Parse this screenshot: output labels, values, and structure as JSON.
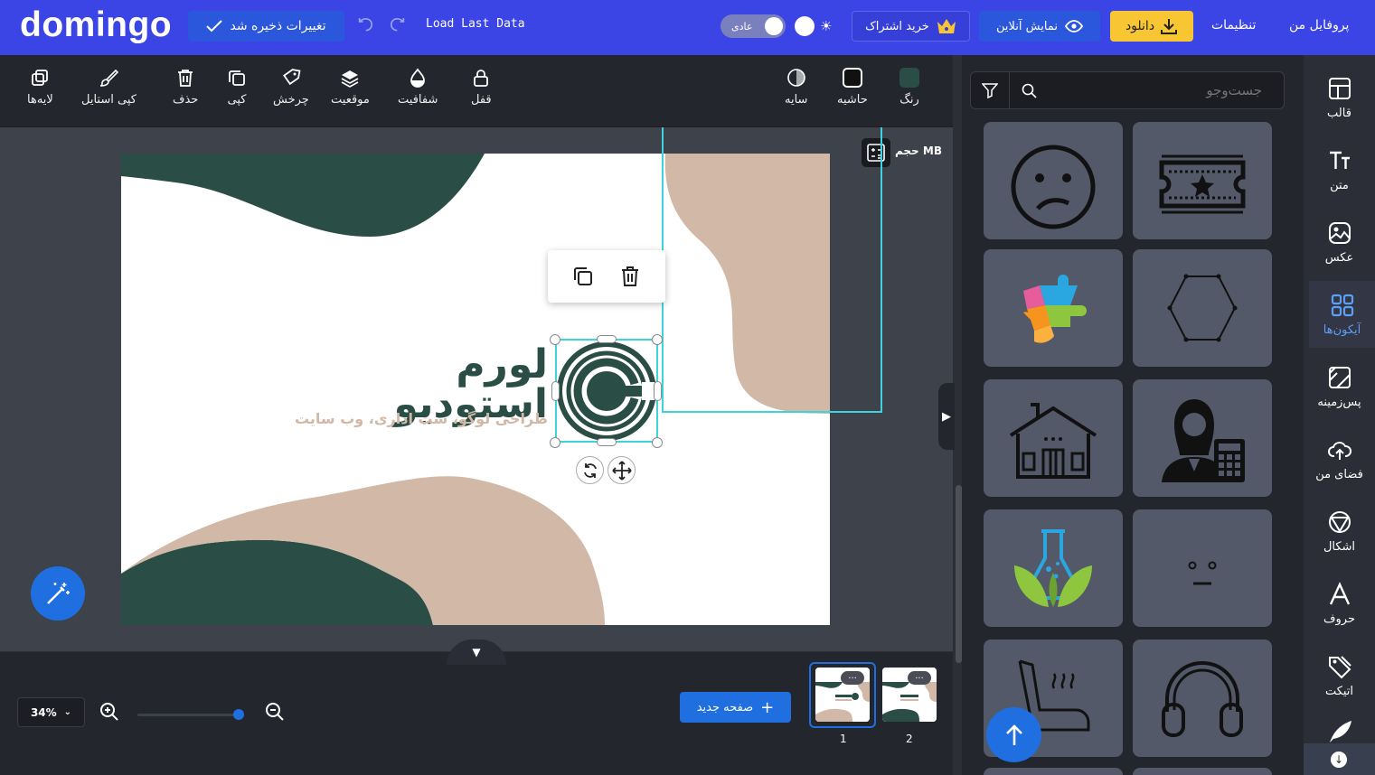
{
  "header": {
    "logo": "domingo",
    "saved_label": "تغییرات ذخیره شد",
    "load_last": "Load Last Data",
    "mode_label": "عادی",
    "subscribe_label": "خرید اشتراک",
    "preview_label": "نمایش آنلاین",
    "download_label": "دانلود",
    "settings_label": "تنظیمات",
    "profile_label": "پروفایل من"
  },
  "toolbar": {
    "right_tools": [
      {
        "label": "رنگ",
        "color": "#2a4d45"
      },
      {
        "label": "حاشیه"
      },
      {
        "label": "سایه"
      }
    ],
    "left_tools": [
      {
        "label": "قفل"
      },
      {
        "label": "شفافیت"
      },
      {
        "label": "موقعیت"
      },
      {
        "label": "چرخش"
      },
      {
        "label": "کپی"
      },
      {
        "label": "حذف"
      },
      {
        "label": "کپی استایل"
      },
      {
        "label": "لایه‌ها"
      }
    ]
  },
  "canvas": {
    "size_label": "حجم MB",
    "logo_title": "لورم استودیو",
    "logo_subtitle": "طراحی لوگو، ست اداری، وب سایت",
    "colors": {
      "dark": "#2a4d45",
      "beige": "#d2b8a6"
    }
  },
  "bottom": {
    "zoom": "34%",
    "new_page_label": "صفحه جدید",
    "pages": [
      "1",
      "2"
    ],
    "page_menu": "..."
  },
  "panel": {
    "search_placeholder": "جست‌وجو",
    "icons": [
      "sad-face",
      "ticket-star",
      "puzzle",
      "hexagon-dots",
      "house",
      "accountant-woman",
      "lab-flask-leaf",
      "neutral-face",
      "chair-steam",
      "headphones"
    ]
  },
  "sidebar": {
    "items": [
      {
        "label": "قالب"
      },
      {
        "label": "متن"
      },
      {
        "label": "عکس"
      },
      {
        "label": "آیکون‌ها"
      },
      {
        "label": "پس‌زمینه"
      },
      {
        "label": "فضای من"
      },
      {
        "label": "اشکال"
      },
      {
        "label": "حروف"
      },
      {
        "label": "اتیکت"
      }
    ]
  },
  "accent_colors": {
    "top": "#3b45e6",
    "primary": "#1f6fe0",
    "download": "#f8c633",
    "selection": "#3fd3e0"
  }
}
